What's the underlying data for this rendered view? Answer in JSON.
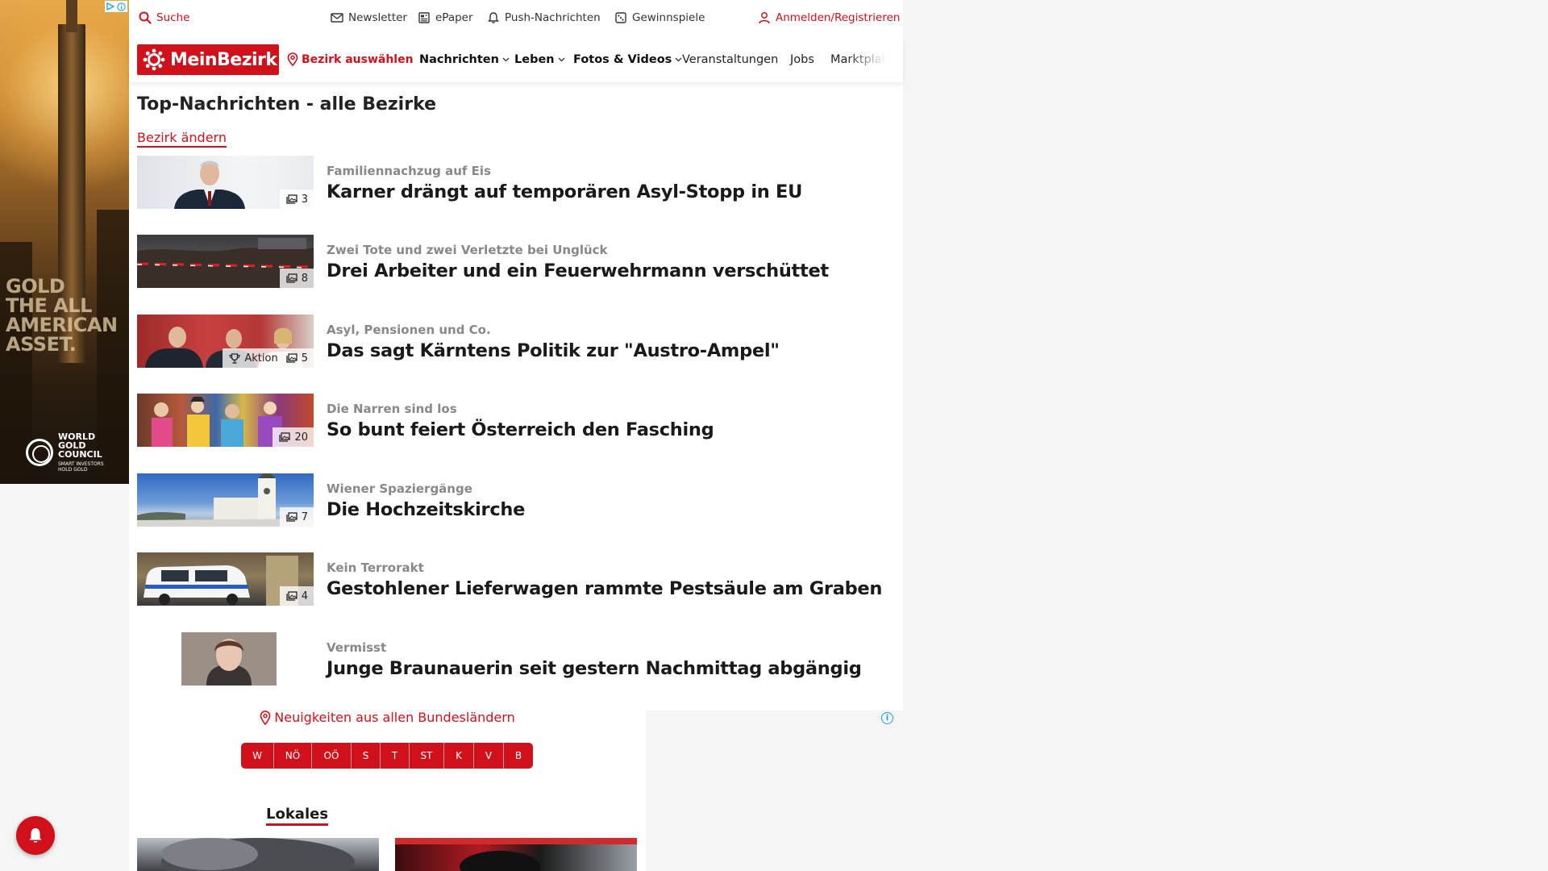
{
  "ad_left": {
    "headline_lines": [
      "GOLD",
      "THE ALL",
      "AMERICAN",
      "ASSET."
    ],
    "brand_lines": [
      "WORLD",
      "GOLD",
      "COUNCIL"
    ],
    "tagline_lines": [
      "SMART INVESTORS",
      "HOLD GOLD"
    ]
  },
  "topbar": {
    "search": "Suche",
    "newsletter": "Newsletter",
    "epaper": "ePaper",
    "push": "Push-Nachrichten",
    "gewinnspiele": "Gewinnspiele",
    "login": "Anmelden/Registrieren"
  },
  "logo": {
    "text": "MeinBezirk"
  },
  "nav": {
    "bezirk": "Bezirk auswählen",
    "nachrichten": "Nachrichten",
    "leben": "Leben",
    "fotos": "Fotos & Videos",
    "veranstaltungen": "Veranstaltungen",
    "jobs": "Jobs",
    "marktplatz": "Marktplatz"
  },
  "section": {
    "title": "Top-Nachrichten - alle Bezirke",
    "change_link": "Bezirk ändern"
  },
  "articles": [
    {
      "kicker": "Familiennachzug auf Eis",
      "headline": "Karner drängt auf temporären Asyl-Stopp in EU",
      "photos": "3",
      "aktion": ""
    },
    {
      "kicker": "Zwei Tote und zwei Verletzte bei Unglück",
      "headline": "Drei Arbeiter und ein Feuerwehrmann verschüttet",
      "photos": "8",
      "aktion": ""
    },
    {
      "kicker": "Asyl, Pensionen und Co.",
      "headline": "Das sagt Kärntens Politik zur \"Austro-Ampel\"",
      "photos": "5",
      "aktion": "Aktion"
    },
    {
      "kicker": "Die Narren sind los",
      "headline": "So bunt feiert Österreich den Fasching",
      "photos": "20",
      "aktion": ""
    },
    {
      "kicker": "Wiener Spaziergänge",
      "headline": "Die Hochzeitskirche",
      "photos": "7",
      "aktion": ""
    },
    {
      "kicker": "Kein Terrorakt",
      "headline": "Gestohlener Lieferwagen rammte Pestsäule am Graben",
      "photos": "4",
      "aktion": ""
    },
    {
      "kicker": "Vermisst",
      "headline": "Junge Braunauerin seit gestern Nachmittag abgängig",
      "photos": "",
      "aktion": ""
    }
  ],
  "regions": {
    "title": "Neuigkeiten aus allen Bundesländern",
    "buttons": [
      "W",
      "NÖ",
      "OÖ",
      "S",
      "T",
      "ST",
      "K",
      "V",
      "B"
    ]
  },
  "lokales": {
    "title": "Lokales"
  },
  "colors": {
    "brand_red": "#d0111b",
    "info_blue": "#1aa0e0"
  }
}
